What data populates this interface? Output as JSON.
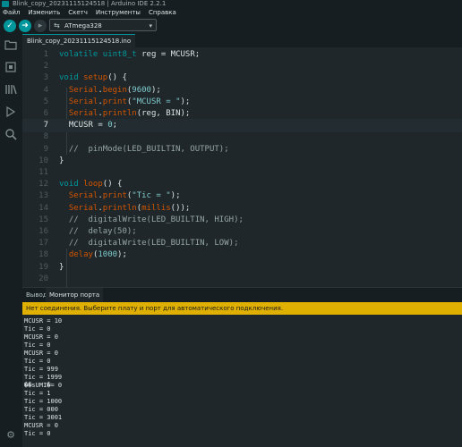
{
  "window": {
    "title": "Blink_copy_20231115124518 | Arduino IDE 2.2.1"
  },
  "menu": [
    "Файл",
    "Изменить",
    "Скетч",
    "Инструменты",
    "Справка"
  ],
  "toolbar": {
    "verify_icon": "check-icon",
    "upload_icon": "arrow-right-icon",
    "debug_icon": "debug-icon",
    "board_name": "ATmega328"
  },
  "sidebar_icons": [
    "folder-icon",
    "boards-icon",
    "library-icon",
    "debug-icon",
    "search-icon"
  ],
  "tabs": [
    {
      "label": "Blink_copy_20231115124518.ino"
    }
  ],
  "editor": {
    "current_line": 7,
    "lines": [
      {
        "n": "1",
        "tokens": [
          [
            "kw",
            "volatile "
          ],
          [
            "kw",
            "uint8_t "
          ],
          [
            "pl",
            "reg = MCUSR;"
          ]
        ]
      },
      {
        "n": "2",
        "tokens": []
      },
      {
        "n": "3",
        "tokens": [
          [
            "kw",
            "void "
          ],
          [
            "fn",
            "setup"
          ],
          [
            "pl",
            "() {"
          ]
        ]
      },
      {
        "n": "4",
        "tokens": [
          [
            "pl",
            "  "
          ],
          [
            "fn",
            "Serial"
          ],
          [
            "pl",
            "."
          ],
          [
            "fn",
            "begin"
          ],
          [
            "pl",
            "("
          ],
          [
            "num",
            "9600"
          ],
          [
            "pl",
            ");"
          ]
        ]
      },
      {
        "n": "5",
        "tokens": [
          [
            "pl",
            "  "
          ],
          [
            "fn",
            "Serial"
          ],
          [
            "pl",
            "."
          ],
          [
            "fn",
            "print"
          ],
          [
            "pl",
            "("
          ],
          [
            "str",
            "\"MCUSR = \""
          ],
          [
            "pl",
            ");"
          ]
        ]
      },
      {
        "n": "6",
        "tokens": [
          [
            "pl",
            "  "
          ],
          [
            "fn",
            "Serial"
          ],
          [
            "pl",
            "."
          ],
          [
            "fn",
            "println"
          ],
          [
            "pl",
            "(reg, BIN);"
          ]
        ]
      },
      {
        "n": "7",
        "tokens": [
          [
            "pl",
            "  MCUSR = "
          ],
          [
            "num",
            "0"
          ],
          [
            "pl",
            ";"
          ]
        ]
      },
      {
        "n": "8",
        "tokens": []
      },
      {
        "n": "9",
        "tokens": [
          [
            "cm",
            "  //  pinMode(LED_BUILTIN, OUTPUT);"
          ]
        ]
      },
      {
        "n": "10",
        "tokens": [
          [
            "pl",
            "}"
          ]
        ]
      },
      {
        "n": "11",
        "tokens": []
      },
      {
        "n": "12",
        "tokens": [
          [
            "kw",
            "void "
          ],
          [
            "fn",
            "loop"
          ],
          [
            "pl",
            "() {"
          ]
        ]
      },
      {
        "n": "13",
        "tokens": [
          [
            "pl",
            "  "
          ],
          [
            "fn",
            "Serial"
          ],
          [
            "pl",
            "."
          ],
          [
            "fn",
            "print"
          ],
          [
            "pl",
            "("
          ],
          [
            "str",
            "\"Tic = \""
          ],
          [
            "pl",
            ");"
          ]
        ]
      },
      {
        "n": "14",
        "tokens": [
          [
            "pl",
            "  "
          ],
          [
            "fn",
            "Serial"
          ],
          [
            "pl",
            "."
          ],
          [
            "fn",
            "println"
          ],
          [
            "pl",
            "("
          ],
          [
            "fn",
            "millis"
          ],
          [
            "pl",
            "());"
          ]
        ]
      },
      {
        "n": "15",
        "tokens": [
          [
            "cm",
            "  //  digitalWrite(LED_BUILTIN, HIGH);"
          ]
        ]
      },
      {
        "n": "16",
        "tokens": [
          [
            "cm",
            "  //  delay(50);"
          ]
        ]
      },
      {
        "n": "17",
        "tokens": [
          [
            "cm",
            "  //  digitalWrite(LED_BUILTIN, LOW);"
          ]
        ]
      },
      {
        "n": "18",
        "tokens": [
          [
            "pl",
            "  "
          ],
          [
            "fn",
            "delay"
          ],
          [
            "pl",
            "("
          ],
          [
            "num",
            "1000"
          ],
          [
            "pl",
            ");"
          ]
        ]
      },
      {
        "n": "19",
        "tokens": [
          [
            "pl",
            "}"
          ]
        ]
      },
      {
        "n": "20",
        "tokens": []
      }
    ]
  },
  "panel": {
    "tabs": [
      "Вывод",
      "Монитор порта"
    ],
    "active_tab": 1,
    "notification": "Нет соединения. Выберите плату и порт для автоматического подключения.",
    "monitor_lines": [
      "MCUSR = 10",
      "Tic = 0",
      "MCUSR = 0",
      "Tic = 0",
      "MCUSR = 0",
      "Tic = 0",
      "Tic = 999",
      "Tic = 1999",
      "��sUMI�= 0",
      "Tic = 1",
      "Tic = 1000",
      "Tic = 000",
      "Tic = 3001",
      "MCUSR = 0",
      "Tic = 0"
    ]
  },
  "colors": {
    "accent": "#00979c",
    "warning": "#e0b000",
    "background": "#1f272a"
  }
}
